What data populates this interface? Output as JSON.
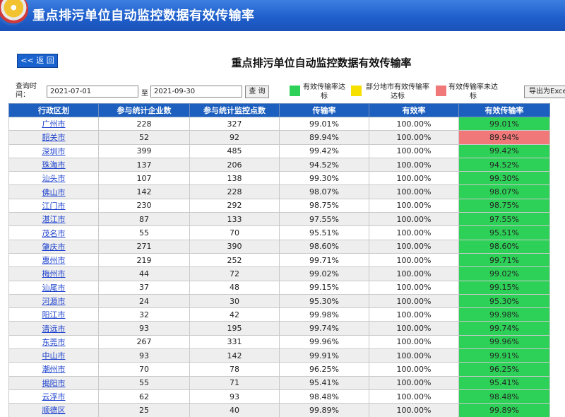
{
  "banner": {
    "title": "重点排污单位自动监控数据有效传输率"
  },
  "page": {
    "title": "重点排污单位自动监控数据有效传输率",
    "back_label": "<< 返 回"
  },
  "query": {
    "label": "查询时间：",
    "start_date": "2021-07-01",
    "to_label": "至",
    "end_date": "2021-09-30",
    "button_label": "查 询",
    "export_label": "导出为Excel"
  },
  "legend": [
    {
      "color": "#2ed158",
      "label": "有效传输率达标"
    },
    {
      "color": "#f5e000",
      "label": "部分地市有效传输率达标"
    },
    {
      "color": "#f07878",
      "label": "有效传输率未达标"
    }
  ],
  "table": {
    "columns": [
      "行政区划",
      "参与统计企业数",
      "参与统计监控点数",
      "传输率",
      "有效率",
      "有效传输率"
    ],
    "rows": [
      {
        "region": "广州市",
        "companies": "228",
        "points": "327",
        "transmission": "99.01%",
        "validity": "100.00%",
        "effective": "99.01%",
        "status": "good"
      },
      {
        "region": "韶关市",
        "companies": "52",
        "points": "92",
        "transmission": "89.94%",
        "validity": "100.00%",
        "effective": "89.94%",
        "status": "bad"
      },
      {
        "region": "深圳市",
        "companies": "399",
        "points": "485",
        "transmission": "99.42%",
        "validity": "100.00%",
        "effective": "99.42%",
        "status": "good"
      },
      {
        "region": "珠海市",
        "companies": "137",
        "points": "206",
        "transmission": "94.52%",
        "validity": "100.00%",
        "effective": "94.52%",
        "status": "good"
      },
      {
        "region": "汕头市",
        "companies": "107",
        "points": "138",
        "transmission": "99.30%",
        "validity": "100.00%",
        "effective": "99.30%",
        "status": "good"
      },
      {
        "region": "佛山市",
        "companies": "142",
        "points": "228",
        "transmission": "98.07%",
        "validity": "100.00%",
        "effective": "98.07%",
        "status": "good"
      },
      {
        "region": "江门市",
        "companies": "230",
        "points": "292",
        "transmission": "98.75%",
        "validity": "100.00%",
        "effective": "98.75%",
        "status": "good"
      },
      {
        "region": "湛江市",
        "companies": "87",
        "points": "133",
        "transmission": "97.55%",
        "validity": "100.00%",
        "effective": "97.55%",
        "status": "good"
      },
      {
        "region": "茂名市",
        "companies": "55",
        "points": "70",
        "transmission": "95.51%",
        "validity": "100.00%",
        "effective": "95.51%",
        "status": "good"
      },
      {
        "region": "肇庆市",
        "companies": "271",
        "points": "390",
        "transmission": "98.60%",
        "validity": "100.00%",
        "effective": "98.60%",
        "status": "good"
      },
      {
        "region": "惠州市",
        "companies": "219",
        "points": "252",
        "transmission": "99.71%",
        "validity": "100.00%",
        "effective": "99.71%",
        "status": "good"
      },
      {
        "region": "梅州市",
        "companies": "44",
        "points": "72",
        "transmission": "99.02%",
        "validity": "100.00%",
        "effective": "99.02%",
        "status": "good"
      },
      {
        "region": "汕尾市",
        "companies": "37",
        "points": "48",
        "transmission": "99.15%",
        "validity": "100.00%",
        "effective": "99.15%",
        "status": "good"
      },
      {
        "region": "河源市",
        "companies": "24",
        "points": "30",
        "transmission": "95.30%",
        "validity": "100.00%",
        "effective": "95.30%",
        "status": "good"
      },
      {
        "region": "阳江市",
        "companies": "32",
        "points": "42",
        "transmission": "99.98%",
        "validity": "100.00%",
        "effective": "99.98%",
        "status": "good"
      },
      {
        "region": "清远市",
        "companies": "93",
        "points": "195",
        "transmission": "99.74%",
        "validity": "100.00%",
        "effective": "99.74%",
        "status": "good"
      },
      {
        "region": "东莞市",
        "companies": "267",
        "points": "331",
        "transmission": "99.96%",
        "validity": "100.00%",
        "effective": "99.96%",
        "status": "good"
      },
      {
        "region": "中山市",
        "companies": "93",
        "points": "142",
        "transmission": "99.91%",
        "validity": "100.00%",
        "effective": "99.91%",
        "status": "good"
      },
      {
        "region": "潮州市",
        "companies": "70",
        "points": "78",
        "transmission": "96.25%",
        "validity": "100.00%",
        "effective": "96.25%",
        "status": "good"
      },
      {
        "region": "揭阳市",
        "companies": "55",
        "points": "71",
        "transmission": "95.41%",
        "validity": "100.00%",
        "effective": "95.41%",
        "status": "good"
      },
      {
        "region": "云浮市",
        "companies": "62",
        "points": "93",
        "transmission": "98.48%",
        "validity": "100.00%",
        "effective": "98.48%",
        "status": "good"
      },
      {
        "region": "顺德区",
        "companies": "25",
        "points": "40",
        "transmission": "99.89%",
        "validity": "100.00%",
        "effective": "99.89%",
        "status": "good"
      }
    ]
  }
}
